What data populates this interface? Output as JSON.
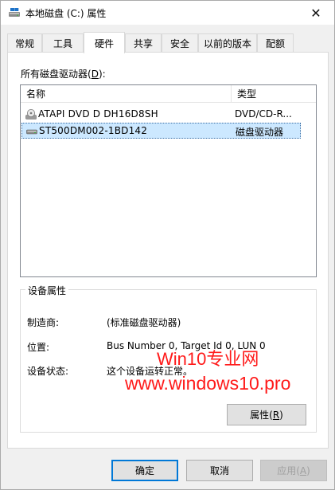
{
  "window": {
    "title": "本地磁盘 (C:) 属性",
    "close_symbol": "✕"
  },
  "tabs": [
    {
      "label": "常规",
      "active": false
    },
    {
      "label": "工具",
      "active": false
    },
    {
      "label": "硬件",
      "active": true
    },
    {
      "label": "共享",
      "active": false
    },
    {
      "label": "安全",
      "active": false
    },
    {
      "label": "以前的版本",
      "active": false
    },
    {
      "label": "配额",
      "active": false
    }
  ],
  "drives": {
    "label_prefix": "所有磁盘驱动器(",
    "label_key": "D",
    "label_suffix": "):",
    "columns": {
      "name": "名称",
      "type": "类型"
    },
    "rows": [
      {
        "icon": "dvd-drive-icon",
        "name": "ATAPI DVD D  DH16D8SH",
        "type": "DVD/CD-R...",
        "selected": false
      },
      {
        "icon": "disk-drive-icon",
        "name": "ST500DM002-1BD142",
        "type": "磁盘驱动器",
        "selected": true
      }
    ]
  },
  "properties": {
    "title": "设备属性",
    "manufacturer_label": "制造商:",
    "manufacturer_value": "(标准磁盘驱动器)",
    "location_label": "位置:",
    "location_value": "Bus Number 0, Target Id 0, LUN 0",
    "status_label": "设备状态:",
    "status_value": "这个设备运转正常。",
    "button_prefix": "属性(",
    "button_key": "R",
    "button_suffix": ")"
  },
  "footer": {
    "ok": "确定",
    "cancel": "取消",
    "apply_prefix": "应用(",
    "apply_key": "A",
    "apply_suffix": ")"
  },
  "watermark": {
    "line1": "Win10专业网",
    "line2": "www.windows10.pro",
    "color": "#ff1a1a"
  }
}
